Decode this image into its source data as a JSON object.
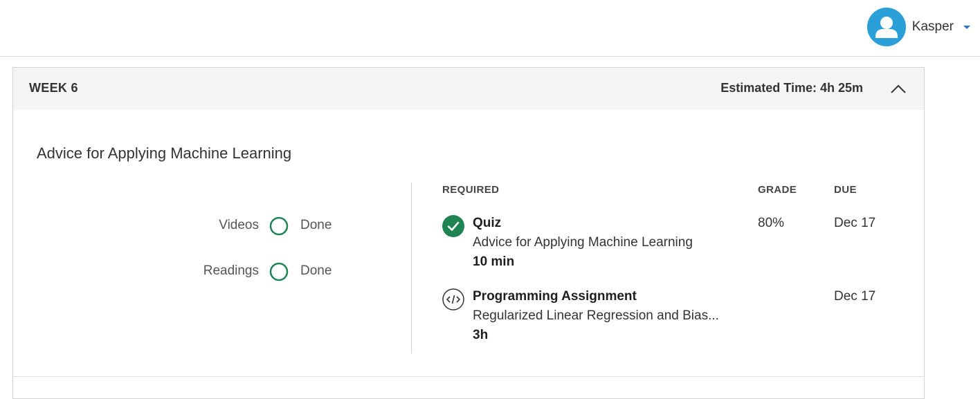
{
  "user": {
    "name": "Kasper",
    "avatar_icon": "user-avatar-icon",
    "menu_icon": "caret-down-icon"
  },
  "colors": {
    "accent_blue": "#2a9fd8",
    "done_green": "#1f8354",
    "header_bg": "#f5f5f5"
  },
  "week": {
    "label": "WEEK 6",
    "estimated_time": "Estimated Time: 4h 25m",
    "collapse_icon": "chevron-up-icon",
    "module_title": "Advice for Applying Machine Learning",
    "progress": [
      {
        "label": "Videos",
        "status": "Done",
        "icon": "circle-outline-icon"
      },
      {
        "label": "Readings",
        "status": "Done",
        "icon": "circle-outline-icon"
      }
    ],
    "columns": {
      "required": "REQUIRED",
      "grade": "GRADE",
      "due": "DUE"
    },
    "items": [
      {
        "icon": "check-circle-icon",
        "title": "Quiz",
        "subtitle": "Advice for Applying Machine Learning",
        "duration": "10 min",
        "grade": "80%",
        "due": "Dec 17"
      },
      {
        "icon": "code-icon",
        "title": "Programming Assignment",
        "subtitle": "Regularized Linear Regression and Bias...",
        "duration": "3h",
        "grade": "",
        "due": "Dec 17"
      }
    ]
  }
}
